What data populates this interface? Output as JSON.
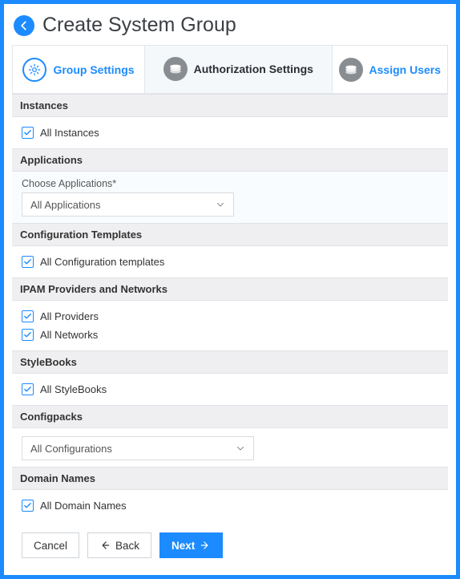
{
  "header": {
    "title": "Create System Group"
  },
  "tabs": {
    "t0": {
      "label": "Group Settings"
    },
    "t1": {
      "label": "Authorization Settings"
    },
    "t2": {
      "label": "Assign Users"
    }
  },
  "sections": {
    "instances": {
      "head": "Instances",
      "check0": "All Instances"
    },
    "applications": {
      "head": "Applications",
      "field_label": "Choose Applications*",
      "select_value": "All Applications"
    },
    "config_templates": {
      "head": "Configuration Templates",
      "check0": "All Configuration templates"
    },
    "ipam": {
      "head": "IPAM Providers and Networks",
      "check0": "All Providers",
      "check1": "All Networks"
    },
    "stylebooks": {
      "head": "StyleBooks",
      "check0": "All StyleBooks"
    },
    "configpacks": {
      "head": "Configpacks",
      "select_value": "All Configurations"
    },
    "domain_names": {
      "head": "Domain Names",
      "check0": "All Domain Names"
    }
  },
  "buttons": {
    "cancel": "Cancel",
    "back": "Back",
    "next": "Next"
  }
}
